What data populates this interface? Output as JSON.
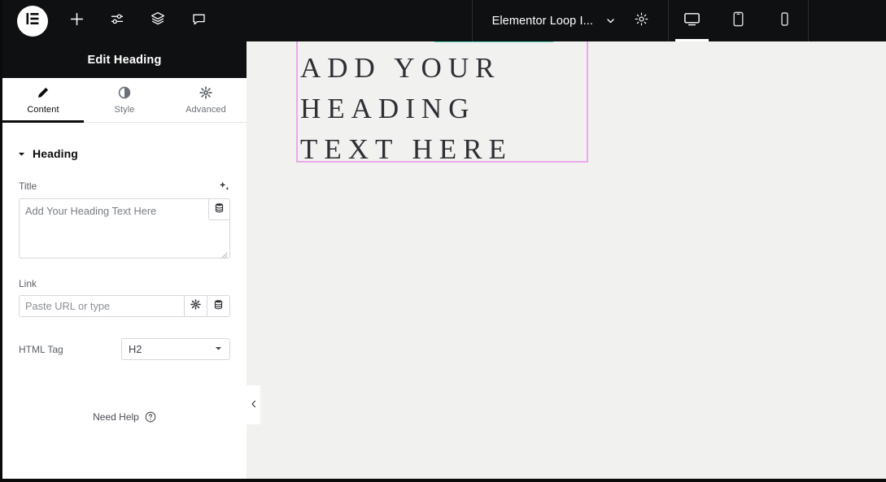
{
  "topbar": {
    "logo_icon": "elementor-logo-icon",
    "buttons": [
      {
        "name": "add-element-button",
        "icon": "plus-icon"
      },
      {
        "name": "page-settings-button",
        "icon": "sliders-icon"
      },
      {
        "name": "navigator-button",
        "icon": "layers-icon"
      },
      {
        "name": "comments-button",
        "icon": "speech-bubble-icon"
      }
    ],
    "document_title": "Elementor Loop I...",
    "document_chevron_icon": "chevron-down-icon",
    "settings_icon": "gear-icon",
    "devices": [
      {
        "name": "desktop",
        "icon": "desktop-icon",
        "active": true
      },
      {
        "name": "tablet",
        "icon": "tablet-icon",
        "active": false
      },
      {
        "name": "mobile",
        "icon": "mobile-icon",
        "active": false
      }
    ]
  },
  "panel": {
    "header_title": "Edit Heading",
    "tabs": [
      {
        "label": "Content",
        "icon": "pencil-icon",
        "active": true
      },
      {
        "label": "Style",
        "icon": "contrast-circle-icon",
        "active": false
      },
      {
        "label": "Advanced",
        "icon": "gear-icon",
        "active": false
      }
    ],
    "section": {
      "title": "Heading",
      "caret_icon": "caret-down-icon"
    },
    "title_field": {
      "label": "Title",
      "ai_icon": "ai-sparkle-icon",
      "value": "Add Your Heading Text Here",
      "dynamic_icon": "dynamic-tags-icon",
      "resize_grip_icon": "resize-grip-icon"
    },
    "link_field": {
      "label": "Link",
      "placeholder": "Paste URL or type",
      "options_icon": "gear-icon",
      "dynamic_icon": "dynamic-tags-icon"
    },
    "html_tag_field": {
      "label": "HTML Tag",
      "value": "H2",
      "chevron_icon": "chevron-down-icon"
    },
    "need_help": {
      "label": "Need Help",
      "icon": "question-circle-icon"
    },
    "collapse_icon": "chevron-left-icon"
  },
  "canvas": {
    "heading_text": "ADD YOUR\nHEADING\nTEXT HERE",
    "selection_border_color": "#e9a9ea",
    "accent_bar_color": "#52d1bb",
    "background_color": "#f1f1ef"
  }
}
